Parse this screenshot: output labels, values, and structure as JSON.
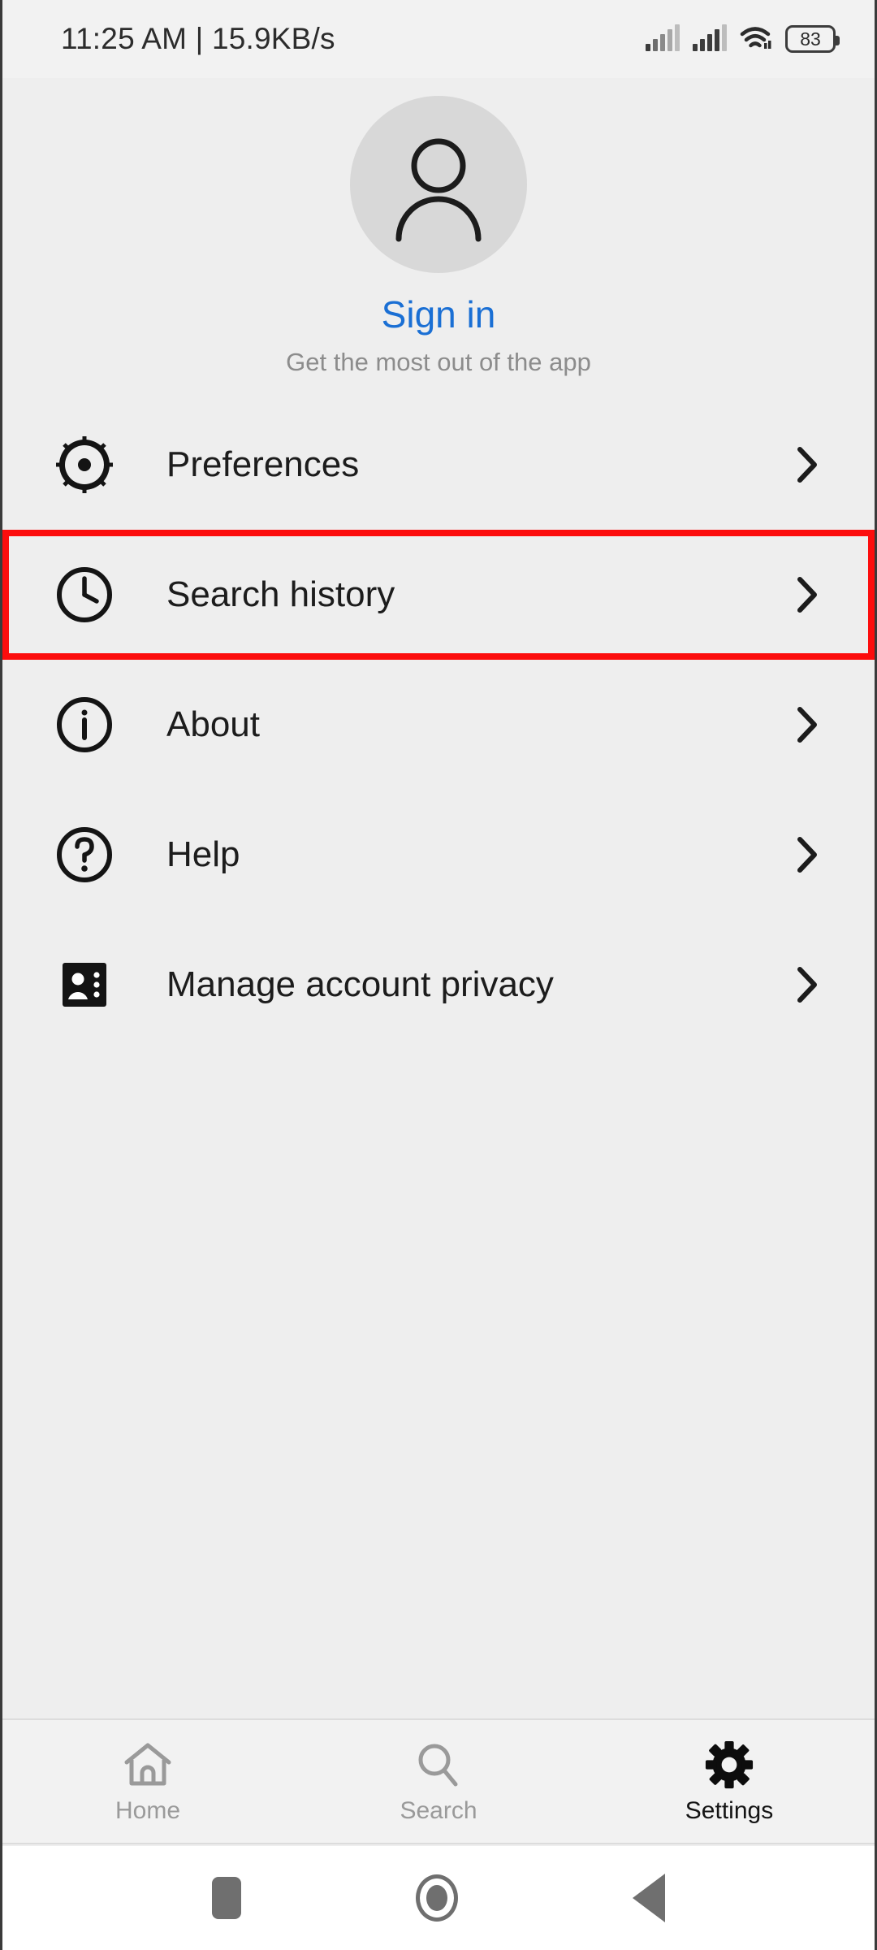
{
  "status_bar": {
    "left_text": "11:25 AM | 15.9KB/s",
    "signal_1_icon": "signal-bars-icon",
    "signal_2_icon": "signal-bars-icon",
    "wifi_icon": "wifi-icon",
    "battery_level": "83"
  },
  "profile": {
    "avatar_icon": "person-avatar-icon",
    "signin_label": "Sign in",
    "signin_subtitle": "Get the most out of the app",
    "signin_color": "#1a6fd4"
  },
  "menu": {
    "items": [
      {
        "label": "Preferences",
        "icon": "gear-cog-icon",
        "highlighted": false
      },
      {
        "label": "Search history",
        "icon": "clock-icon",
        "highlighted": true
      },
      {
        "label": "About",
        "icon": "info-icon",
        "highlighted": false
      },
      {
        "label": "Help",
        "icon": "question-icon",
        "highlighted": false
      },
      {
        "label": "Manage account privacy",
        "icon": "id-badge-icon",
        "highlighted": false
      }
    ],
    "chevron_icon": "chevron-right-icon",
    "highlight_color": "#fc0d0d"
  },
  "bottom_nav": {
    "items": [
      {
        "label": "Home",
        "icon": "home-icon",
        "active": false
      },
      {
        "label": "Search",
        "icon": "search-icon",
        "active": false
      },
      {
        "label": "Settings",
        "icon": "gear-icon",
        "active": true
      }
    ]
  },
  "android_nav": {
    "recents_icon": "recents-square-icon",
    "home_icon": "home-circle-icon",
    "back_icon": "back-triangle-icon"
  }
}
